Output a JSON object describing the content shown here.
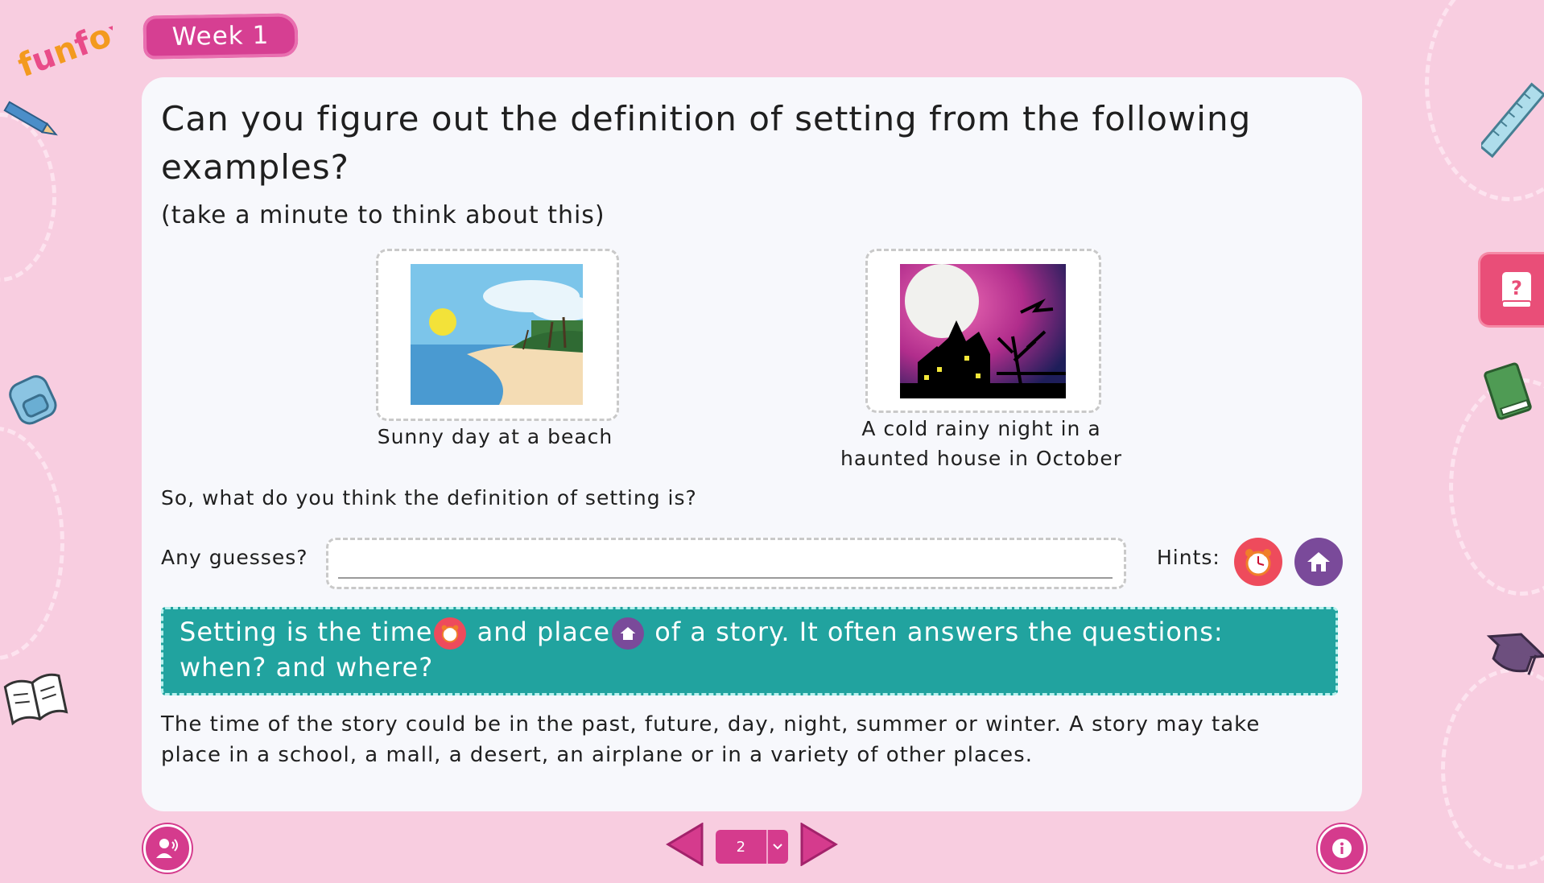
{
  "brand": {
    "logo_text": "funfox"
  },
  "header": {
    "week_label": "Week 1"
  },
  "question": {
    "title": "Can you figure out the definition of setting from the following examples?",
    "subtitle": "(take a minute to think about this)"
  },
  "examples": [
    {
      "caption": "Sunny day at a beach",
      "image": "beach-image"
    },
    {
      "caption": "A cold rainy night in a haunted house in October",
      "image": "haunted-house-image"
    }
  ],
  "prompt": "So, what do you think the definition of setting is?",
  "guess": {
    "label": "Any guesses?",
    "value": "",
    "placeholder": ""
  },
  "hints": {
    "label": "Hints:",
    "items": [
      {
        "icon": "alarm-clock-icon"
      },
      {
        "icon": "house-icon"
      }
    ]
  },
  "definition": {
    "part1": "Setting is the time",
    "part2": "and place",
    "part3": "of a story. It often answers the questions: when? and where?"
  },
  "explanation": "The time of the story could be in the past, future, day, night, summer or winter. A story may take place in a school, a mall, a desert, an airplane or in a variety of other places.",
  "pagination": {
    "current_page": "2"
  },
  "colors": {
    "accent": "#d53b8d",
    "teal": "#21a39f",
    "background": "#f8cde0",
    "clock_red": "#ee4b5c",
    "house_purple": "#7a4a9a"
  }
}
